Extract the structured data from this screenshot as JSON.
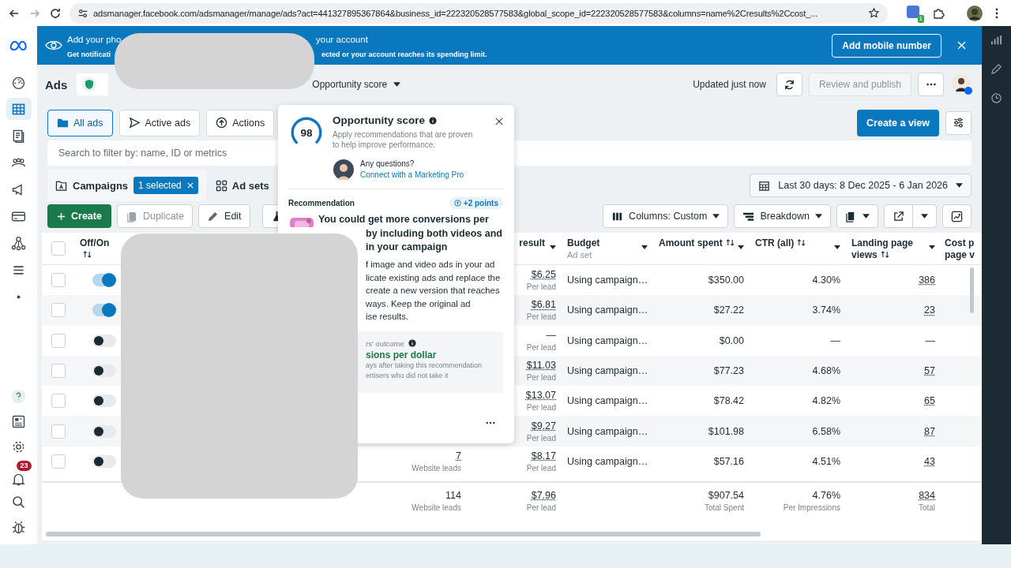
{
  "browser": {
    "url": "adsmanager.facebook.com/adsmanager/manage/ads?act=441327895367864&business_id=222320528577583&global_scope_id=222320528577583&columns=name%2Cresults%2Ccost_...",
    "extension_badge": "1"
  },
  "banner": {
    "title_start": "Add your pho",
    "title_end": "your account",
    "subtitle_start": "Get notificati",
    "subtitle_end": "ected or your account reaches its spending limit.",
    "button": "Add mobile number"
  },
  "sidebar": {
    "items": [
      {
        "selected": false
      },
      {
        "selected": true
      },
      {
        "selected": false
      },
      {
        "selected": false
      },
      {
        "selected": false
      },
      {
        "selected": false
      },
      {
        "selected": false
      },
      {
        "selected": false
      },
      {
        "selected": false
      }
    ],
    "bottom_items": [
      {
        "selected": false
      },
      {
        "selected": false
      },
      {
        "selected": false
      },
      {
        "selected": false,
        "badge": "23"
      },
      {
        "selected": false
      },
      {
        "selected": false
      }
    ]
  },
  "header": {
    "title": "Ads",
    "opportunity_button": "Opportunity score",
    "updated": "Updated just now",
    "publish_button": {
      "label": "Review and publish",
      "disabled": true
    }
  },
  "view_tabs": [
    {
      "label": "All ads",
      "selected": true
    },
    {
      "label": "Active ads",
      "selected": false
    },
    {
      "label": "Actions",
      "selected": false
    }
  ],
  "create_view_button": "Create a view",
  "search": {
    "placeholder": "Search to filter by: name, ID or metrics"
  },
  "level_tabs": {
    "campaigns": "Campaigns",
    "selected_badge": "1 selected",
    "ad_sets": "Ad sets"
  },
  "date_range": "Last 30 days: 8 Dec 2025 - 6 Jan 2026",
  "toolbar": {
    "create": "Create",
    "duplicate": {
      "label": "Duplicate",
      "disabled": true
    },
    "edit": {
      "label": "Edit",
      "disabled": false
    },
    "columns": "Columns: Custom",
    "breakdown": "Breakdown"
  },
  "table": {
    "select_all_checked": false,
    "columns": [
      {
        "label": "Off/On",
        "sortable": true,
        "dropdown": false
      },
      {
        "label": "result",
        "sortable": false,
        "dropdown": true
      },
      {
        "label": "Budget",
        "sublabel": "Ad set",
        "sortable": false,
        "dropdown": true
      },
      {
        "label": "Amount spent",
        "sortable": true,
        "dropdown": true
      },
      {
        "label": "CTR (all)",
        "sortable": true,
        "dropdown": true
      },
      {
        "label": "Landing page views",
        "sortable": true,
        "dropdown": true
      },
      {
        "label": "Cost p\npage v",
        "sortable": false,
        "dropdown": false
      }
    ],
    "rows": [
      {
        "checked": false,
        "on": true,
        "cost": "$6.25",
        "cost_note": "Per lead",
        "budget": "Using campaign…",
        "amount": "$350.00",
        "ctr": "4.30%",
        "lpv": "386"
      },
      {
        "checked": false,
        "on": true,
        "cost": "$6.81",
        "cost_note": "Per lead",
        "budget": "Using campaign…",
        "amount": "$27.22",
        "ctr": "3.74%",
        "lpv": "23"
      },
      {
        "checked": false,
        "on": false,
        "cost": "—",
        "cost_note": "Per lead",
        "budget": "Using campaign…",
        "amount": "$0.00",
        "ctr": "—",
        "lpv": "—"
      },
      {
        "checked": false,
        "on": false,
        "cost": "$11.03",
        "cost_note": "Per lead",
        "budget": "Using campaign…",
        "amount": "$77.23",
        "ctr": "4.68%",
        "lpv": "57"
      },
      {
        "checked": false,
        "on": false,
        "cost": "$13.07",
        "cost_note": "Per lead",
        "budget": "Using campaign…",
        "amount": "$78.42",
        "ctr": "4.82%",
        "lpv": "65"
      },
      {
        "checked": false,
        "on": false,
        "cost": "$9.27",
        "cost_note": "Per lead",
        "budget": "Using campaign…",
        "amount": "$101.98",
        "ctr": "6.58%",
        "lpv": "87"
      },
      {
        "checked": false,
        "on": false,
        "results": "7",
        "results_note": "Website leads",
        "cost": "$8.17",
        "cost_note": "Per lead",
        "budget": "Using campaign…",
        "amount": "$57.16",
        "ctr": "4.51%",
        "lpv": "43"
      }
    ],
    "totals": {
      "results": "114",
      "results_note": "Website leads",
      "cost": "$7.96",
      "cost_note": "Per lead",
      "amount": "$907.54",
      "amount_note": "Total Spent",
      "ctr": "4.76%",
      "ctr_note": "Per Impressions",
      "lpv": "834",
      "lpv_note": "Total"
    }
  },
  "opportunity_popup": {
    "score": "98",
    "title": "Opportunity score",
    "description": "Apply recommendations that are proven to help improve performance.",
    "question": "Any questions?",
    "link": "Connect with a Marketing Pro",
    "section": "Recommendation",
    "points": "+2 points",
    "headline_first": "You could get more conversions per",
    "headline_rest": [
      "by including both videos and",
      "in your campaign"
    ],
    "body_lines": [
      "f image and video ads in your ad",
      "licate existing ads and replace the",
      "create a new version that reaches",
      "ways. Keep the original ad",
      "ise results."
    ],
    "outcome_label": "rs' outcome",
    "outcome_metric": "sions per dollar",
    "outcome_notes": [
      "ays after taking this recommendation",
      "ertisers who did not take it"
    ]
  }
}
